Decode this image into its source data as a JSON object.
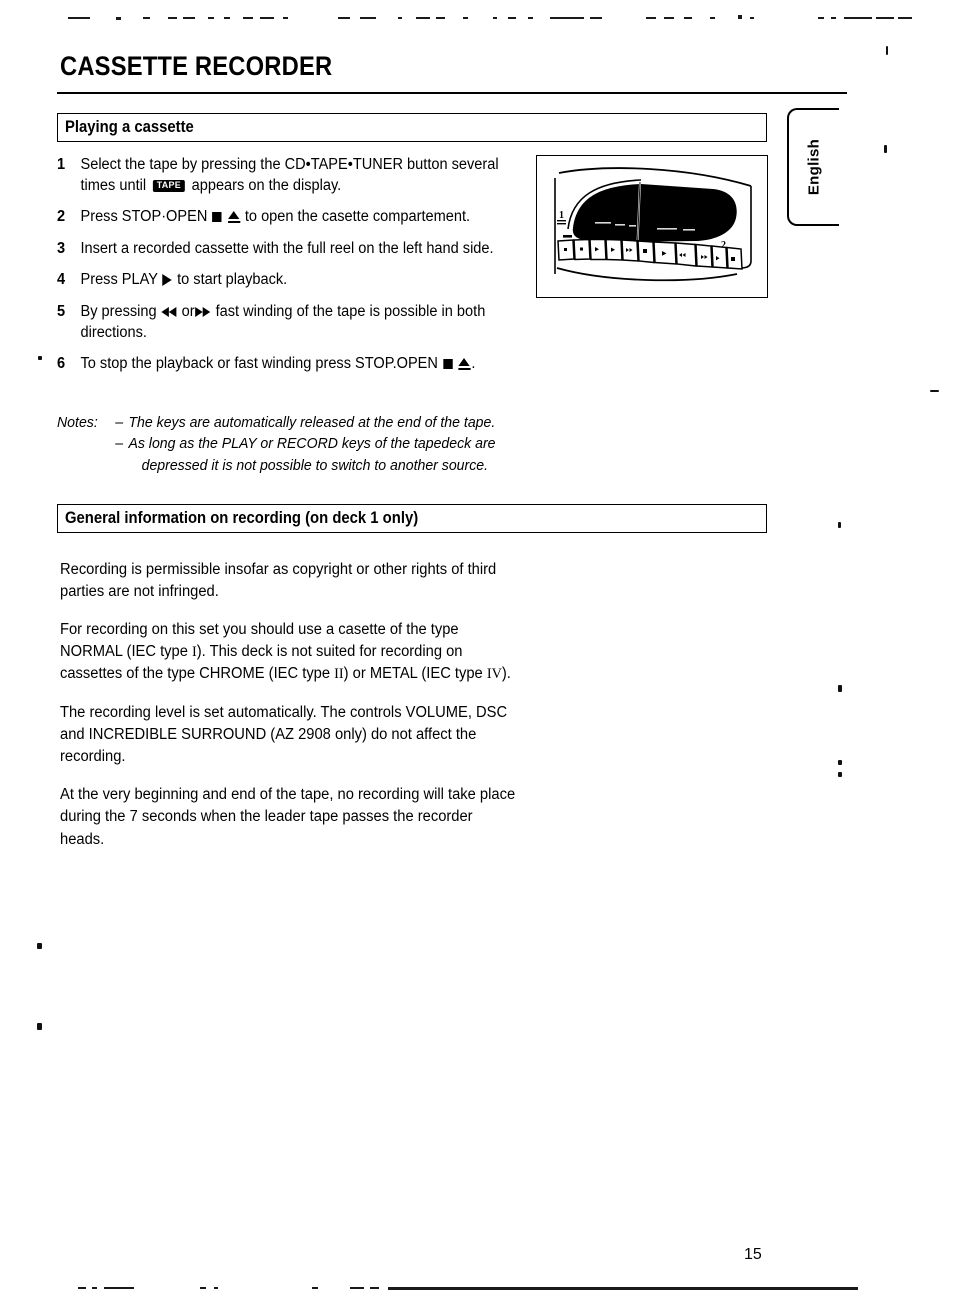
{
  "document": {
    "title": "CASSETTE RECORDER",
    "page_number": "15",
    "language_tab": "English"
  },
  "sections": {
    "playing": {
      "header": "Playing a cassette",
      "steps": [
        {
          "number": "1",
          "parts": [
            {
              "type": "text",
              "value": "Select the tape by pressing the CD•TAPE•TUNER button several times until "
            },
            {
              "type": "badge",
              "value": "TAPE"
            },
            {
              "type": "text",
              "value": " appears on the display."
            }
          ]
        },
        {
          "number": "2",
          "parts": [
            {
              "type": "text",
              "value": "Press STOP·OPEN "
            },
            {
              "type": "icon",
              "value": "stop-square-icon"
            },
            {
              "type": "text",
              "value": " "
            },
            {
              "type": "icon",
              "value": "eject-triangle-icon"
            },
            {
              "type": "text",
              "value": " to open the casette compartement."
            }
          ]
        },
        {
          "number": "3",
          "parts": [
            {
              "type": "text",
              "value": "Insert a recorded cassette with the full reel on the left hand side."
            }
          ]
        },
        {
          "number": "4",
          "parts": [
            {
              "type": "text",
              "value": "Press PLAY "
            },
            {
              "type": "icon",
              "value": "play-triangle-icon"
            },
            {
              "type": "text",
              "value": " to start playback."
            }
          ]
        },
        {
          "number": "5",
          "parts": [
            {
              "type": "text",
              "value": "By pressing "
            },
            {
              "type": "icon",
              "value": "rewind-icon"
            },
            {
              "type": "text",
              "value": " or"
            },
            {
              "type": "icon",
              "value": "fast-forward-icon"
            },
            {
              "type": "text",
              "value": " fast winding of the tape is possible in both directions."
            }
          ]
        },
        {
          "number": "6",
          "parts": [
            {
              "type": "text",
              "value": "To stop the playback or fast winding press STOP.OPEN "
            },
            {
              "type": "icon",
              "value": "stop-square-icon"
            },
            {
              "type": "text",
              "value": " "
            },
            {
              "type": "icon",
              "value": "eject-triangle-icon"
            },
            {
              "type": "text",
              "value": "."
            }
          ]
        }
      ],
      "notes": {
        "label": "Notes:",
        "dash": "–",
        "items": [
          {
            "line1": "The keys are automatically released at the end of the tape.",
            "line2": ""
          },
          {
            "line1": "As long as the PLAY or RECORD keys of the tapedeck are",
            "line2": "depressed it is not possible to switch to another source."
          }
        ]
      }
    },
    "recording": {
      "header": "General information on recording (on deck 1 only)",
      "paragraphs": [
        {
          "parts": [
            {
              "type": "text",
              "value": "Recording is permissible insofar as copyright or other rights of third parties are not infringed."
            }
          ]
        },
        {
          "parts": [
            {
              "type": "text",
              "value": "For recording on this set you should use a casette of the type NORMAL (IEC type "
            },
            {
              "type": "roman",
              "value": "I"
            },
            {
              "type": "text",
              "value": "). This deck is not suited for recording on cassettes of the type CHROME (IEC type "
            },
            {
              "type": "roman",
              "value": "II"
            },
            {
              "type": "text",
              "value": ") or METAL (IEC type "
            },
            {
              "type": "roman",
              "value": "IV"
            },
            {
              "type": "text",
              "value": ")."
            }
          ]
        },
        {
          "parts": [
            {
              "type": "text",
              "value": "The recording level is set automatically. The controls VOLUME, DSC and INCREDIBLE SURROUND (AZ 2908 only) do not affect the recording."
            }
          ]
        },
        {
          "parts": [
            {
              "type": "text",
              "value": "At the very beginning and end of the tape, no recording will take place during the 7 seconds when the leader tape passes the recorder heads."
            }
          ]
        }
      ]
    }
  },
  "illustration": {
    "name": "dual-cassette-deck-diagram",
    "deck_labels": [
      "1",
      "2"
    ],
    "description": "Front panel view of dual cassette deck with two cassette doors and a row of transport control buttons"
  },
  "colors": {
    "ink": "#000000",
    "paper": "#ffffff"
  }
}
